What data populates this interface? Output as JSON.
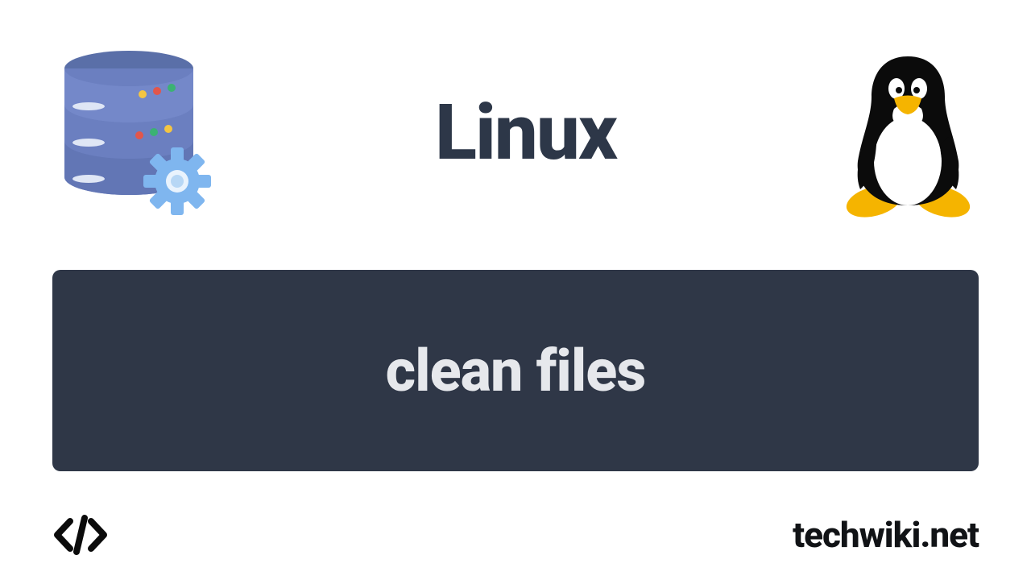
{
  "header": {
    "title": "Linux"
  },
  "card": {
    "text": "clean files"
  },
  "footer": {
    "site": "techwiki.net"
  },
  "colors": {
    "card_bg": "#2f3747",
    "text_dark": "#2d3748",
    "text_light": "#e6e8ec"
  }
}
